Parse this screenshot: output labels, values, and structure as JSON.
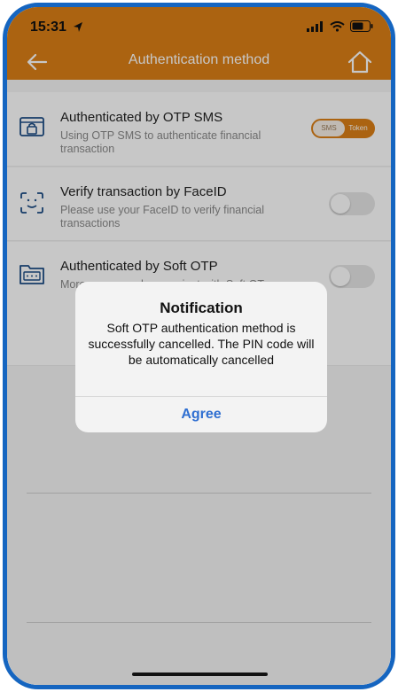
{
  "status_bar": {
    "time": "15:31"
  },
  "header": {
    "title": "Authentication method"
  },
  "items": [
    {
      "title": "Authenticated by OTP SMS",
      "description": "Using OTP SMS to authenticate financial transaction",
      "toggle_left": "SMS",
      "toggle_right": "Token"
    },
    {
      "title": "Verify transaction by FaceID",
      "description": " Please use your FaceID to verify financial transactions"
    },
    {
      "title": "Authenticated by Soft OTP",
      "description": "More secure and convenient with Soft OT"
    }
  ],
  "dialog": {
    "title": "Notification",
    "message": "Soft OTP authentication method is successfully cancelled. The PIN code will be automatically cancelled",
    "button": "Agree"
  },
  "colors": {
    "header": "#db7f16",
    "dialog_button": "#2f6fd1",
    "frame": "#1565c0"
  }
}
